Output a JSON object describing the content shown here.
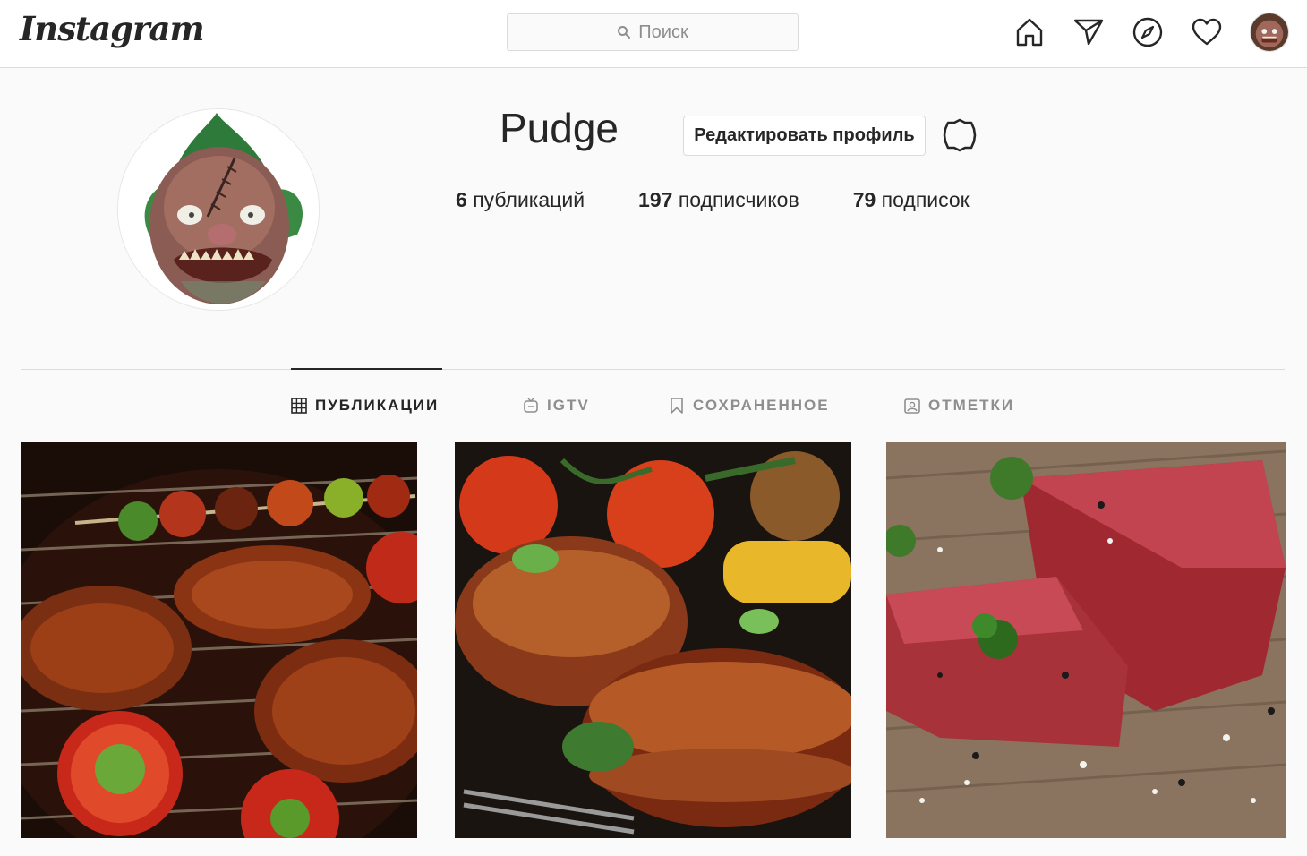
{
  "topbar": {
    "logo": "Instagram",
    "search_placeholder": "Поиск",
    "icons": [
      "home-icon",
      "direct-send-icon",
      "explore-compass-icon",
      "activity-heart-icon",
      "profile-avatar"
    ]
  },
  "profile": {
    "username": "Pudge",
    "edit_label": "Редактировать профиль",
    "stats": [
      {
        "num": "6",
        "label": "публикаций"
      },
      {
        "num": "197",
        "label": "подписчиков"
      },
      {
        "num": "79",
        "label": "подписок"
      }
    ]
  },
  "tabs": [
    {
      "label": "ПУБЛИКАЦИИ",
      "icon": "grid-icon",
      "active": true
    },
    {
      "label": "IGTV",
      "icon": "igtv-icon",
      "active": false
    },
    {
      "label": "СОХРАНЕННОЕ",
      "icon": "bookmark-icon",
      "active": false
    },
    {
      "label": "ОТМЕТКИ",
      "icon": "tagged-icon",
      "active": false
    }
  ],
  "posts": [
    {
      "subject": "grilled meat and vegetables on barbecue grill"
    },
    {
      "subject": "grilled steaks with tomatoes and herbs"
    },
    {
      "subject": "raw beef steaks with parsley and salt"
    }
  ],
  "colors": {
    "text": "#262626",
    "secondary": "#8e8e8e",
    "border": "#dbdbdb",
    "background": "#fafafa"
  }
}
